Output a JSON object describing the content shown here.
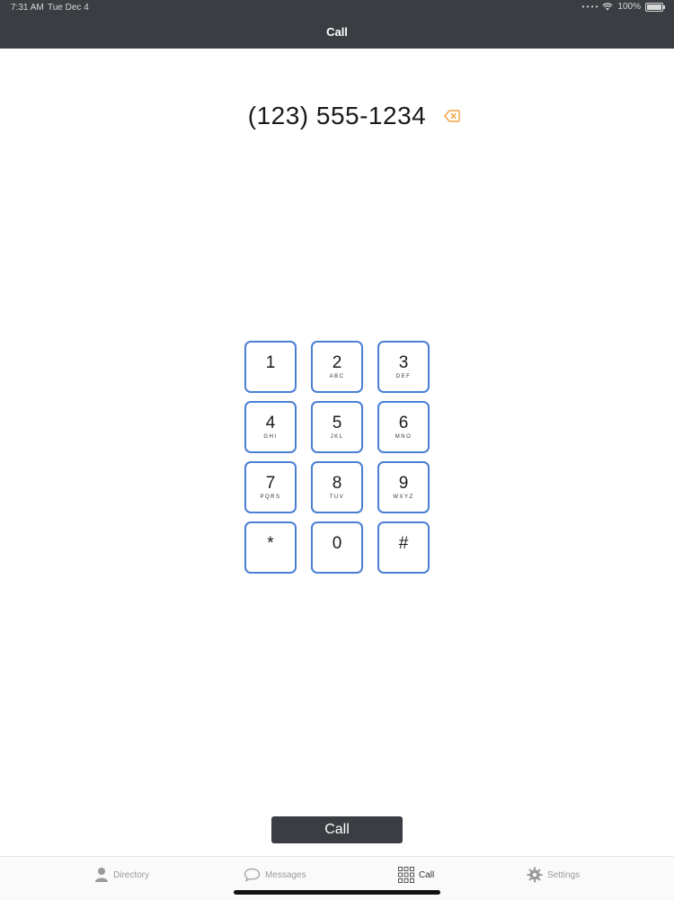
{
  "status_bar": {
    "time": "7:31 AM",
    "date": "Tue Dec 4",
    "battery": "100%"
  },
  "nav": {
    "title": "Call"
  },
  "dialer": {
    "number": "(123) 555-1234",
    "backspace_icon": "backspace-icon",
    "accent_color": "#f0a040"
  },
  "keypad": [
    {
      "digit": "1",
      "letters": ""
    },
    {
      "digit": "2",
      "letters": "ABC"
    },
    {
      "digit": "3",
      "letters": "DEF"
    },
    {
      "digit": "4",
      "letters": "GHI"
    },
    {
      "digit": "5",
      "letters": "JKL"
    },
    {
      "digit": "6",
      "letters": "MNO"
    },
    {
      "digit": "7",
      "letters": "PQRS"
    },
    {
      "digit": "8",
      "letters": "TUV"
    },
    {
      "digit": "9",
      "letters": "WXYZ"
    },
    {
      "digit": "*",
      "letters": ""
    },
    {
      "digit": "0",
      "letters": ""
    },
    {
      "digit": "#",
      "letters": ""
    }
  ],
  "key_border_color": "#4a7fd4",
  "call_button": {
    "label": "Call"
  },
  "tabs": [
    {
      "label": "Directory",
      "icon": "person-icon",
      "active": false
    },
    {
      "label": "Messages",
      "icon": "speech-bubble-icon",
      "active": false
    },
    {
      "label": "Call",
      "icon": "keypad-grid-icon",
      "active": true
    },
    {
      "label": "Settings",
      "icon": "gear-icon",
      "active": false
    }
  ]
}
